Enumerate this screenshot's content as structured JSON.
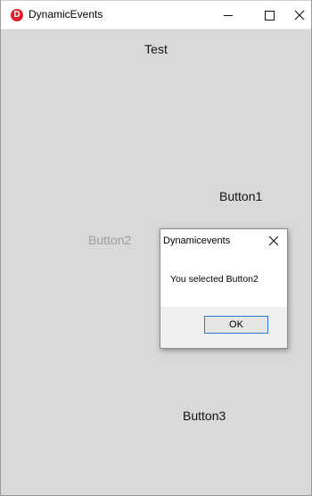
{
  "window": {
    "title": "DynamicEvents",
    "app_icon_letter": "D",
    "app_icon_color": "#e0202a",
    "background_color": "#d9d9d9"
  },
  "page": {
    "title": "Test",
    "buttons": [
      {
        "label": "Button1"
      },
      {
        "label": "Button2"
      },
      {
        "label": "Button3"
      }
    ]
  },
  "dialog": {
    "title": "Dynamicevents",
    "message": "You selected Button2",
    "ok_label": "OK",
    "accent_color": "#2d7ad6"
  }
}
